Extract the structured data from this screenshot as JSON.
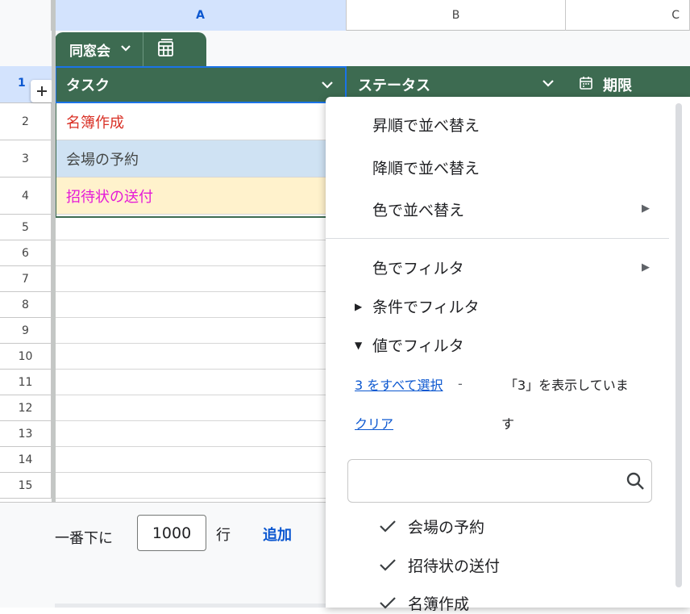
{
  "columns": {
    "a": "A",
    "b": "B",
    "c": "C"
  },
  "table": {
    "name": "同窓会"
  },
  "header": {
    "row_number": "1",
    "task": "タスク",
    "status": "ステータス",
    "deadline": "期限"
  },
  "rows": [
    {
      "num": "2",
      "task": "名簿作成",
      "color": "#d93025",
      "bg": "#ffffff"
    },
    {
      "num": "3",
      "task": "会場の予約",
      "color": "#444746",
      "bg": "#cfe2f3"
    },
    {
      "num": "4",
      "task": "招待状の送付",
      "color": "#e51ad7",
      "bg": "#fff2cc"
    }
  ],
  "empty_rows": [
    "5",
    "6",
    "7",
    "8",
    "9",
    "10",
    "11",
    "12",
    "13",
    "14",
    "15"
  ],
  "footer": {
    "label": "一番下に",
    "value": "1000",
    "unit": "行",
    "add": "追加"
  },
  "menu": {
    "sort_asc": "昇順で並べ替え",
    "sort_desc": "降順で並べ替え",
    "sort_color": "色で並べ替え",
    "filter_color": "色でフィルタ",
    "filter_condition": "条件でフィルタ",
    "filter_values": "値でフィルタ",
    "select_all": "3 をすべて選択",
    "dash": "-",
    "clear": "クリア",
    "showing_line1": "「3」を表示していま",
    "showing_line2": "す",
    "values": [
      "会場の予約",
      "招待状の送付",
      "名簿作成"
    ]
  },
  "colors": {
    "table_green": "#3d6b51",
    "accent_blue": "#0b57d0"
  }
}
